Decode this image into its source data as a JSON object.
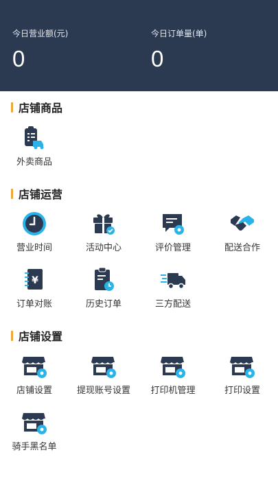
{
  "header": {
    "stats": [
      {
        "label": "今日营业额(元)",
        "value": "0"
      },
      {
        "label": "今日订单量(单)",
        "value": "0"
      }
    ]
  },
  "sections": [
    {
      "title": "店铺商品",
      "items": [
        {
          "label": "外卖商品",
          "icon": "takeout-goods-icon"
        }
      ]
    },
    {
      "title": "店铺运营",
      "items": [
        {
          "label": "营业时间",
          "icon": "clock-icon"
        },
        {
          "label": "活动中心",
          "icon": "gift-icon"
        },
        {
          "label": "评价管理",
          "icon": "review-icon"
        },
        {
          "label": "配送合作",
          "icon": "handshake-icon"
        },
        {
          "label": "订单对账",
          "icon": "yen-bill-icon"
        },
        {
          "label": "历史订单",
          "icon": "history-order-icon"
        },
        {
          "label": "三方配送",
          "icon": "delivery-truck-icon"
        }
      ]
    },
    {
      "title": "店铺设置",
      "items": [
        {
          "label": "店铺设置",
          "icon": "store-settings-icon"
        },
        {
          "label": "提现账号设置",
          "icon": "store-settings-icon"
        },
        {
          "label": "打印机管理",
          "icon": "store-settings-icon"
        },
        {
          "label": "打印设置",
          "icon": "store-settings-icon"
        },
        {
          "label": "骑手黑名单",
          "icon": "store-settings-icon"
        }
      ]
    }
  ],
  "colors": {
    "header_bg": "#2b3a50",
    "icon_dark": "#2b3a50",
    "icon_accent": "#29b3e8",
    "section_bar": "#f0a637"
  }
}
